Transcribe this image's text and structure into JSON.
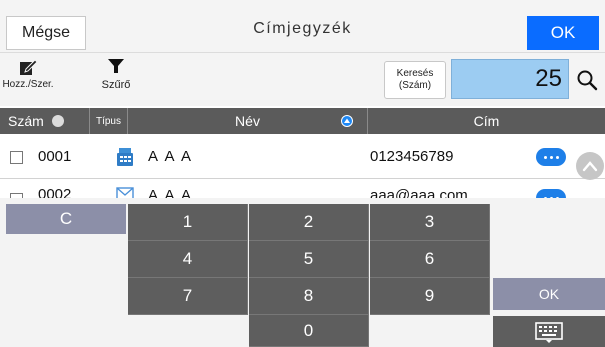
{
  "titlebar": {
    "cancel_label": "Mégse",
    "title": "Címjegyzék",
    "ok_label": "OK"
  },
  "toolbar": {
    "add_edit_label": "Hozz./Szer.",
    "filter_label": "Szűrő",
    "search_label_line1": "Keresés",
    "search_label_line2": "(Szám)",
    "search_value": "25",
    "search_icon": "magnifier-icon"
  },
  "table": {
    "headers": {
      "number": "Szám",
      "type": "Típus",
      "name": "Név",
      "address": "Cím"
    },
    "rows": [
      {
        "number": "0001",
        "type_icon": "fax-icon",
        "name": "A A A",
        "address": "0123456789"
      },
      {
        "number": "0002",
        "type_icon": "email-icon",
        "name": "A A A",
        "address": "aaa@aaa.com"
      }
    ]
  },
  "keypad": {
    "clear_label": "C",
    "digits": [
      "1",
      "2",
      "3",
      "4",
      "5",
      "6",
      "7",
      "8",
      "9",
      "0"
    ],
    "ok_label": "OK",
    "keyboard_icon": "keyboard-icon"
  },
  "colors": {
    "primary": "#0a6cff",
    "header_bg": "#5b5b5b",
    "keypad_key": "#5e5e5e",
    "keypad_action": "#8c8fa8",
    "search_field": "#9cccf2"
  }
}
